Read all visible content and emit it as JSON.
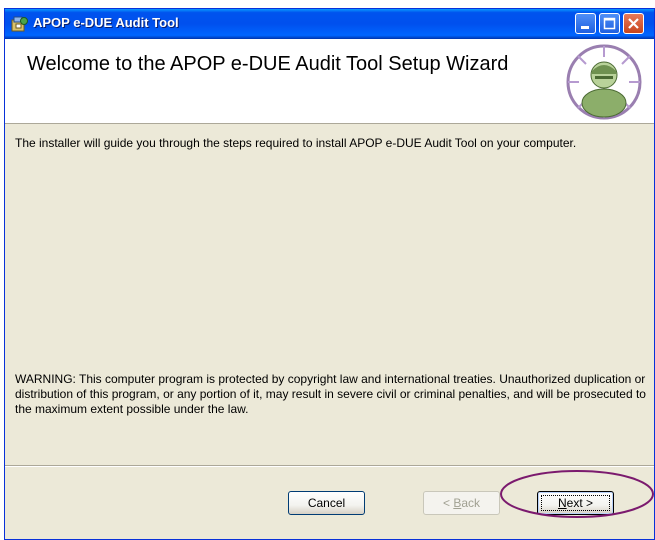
{
  "window": {
    "title": "APOP e-DUE Audit Tool",
    "icon": "installer-icon",
    "controls": [
      "minimize",
      "maximize",
      "close"
    ]
  },
  "header": {
    "title": "Welcome to the APOP e-DUE Audit Tool Setup Wizard",
    "logo": "user-setup-icon"
  },
  "body": {
    "intro": "The installer will guide you through the steps required to install APOP e-DUE Audit Tool on your computer.",
    "warning": "WARNING: This computer program is protected by copyright law and international treaties. Unauthorized duplication or distribution of this program, or any portion of it, may result in severe civil or criminal penalties, and will be prosecuted to the maximum extent possible under the law."
  },
  "buttons": {
    "cancel": "Cancel",
    "back_prefix": "< ",
    "back_key": "B",
    "back_rest": "ack",
    "next_key": "N",
    "next_rest": "ext >"
  },
  "colors": {
    "titlebar": "#0053ee",
    "window_bg": "#ece9d8",
    "annotation": "#7b1a6e"
  }
}
